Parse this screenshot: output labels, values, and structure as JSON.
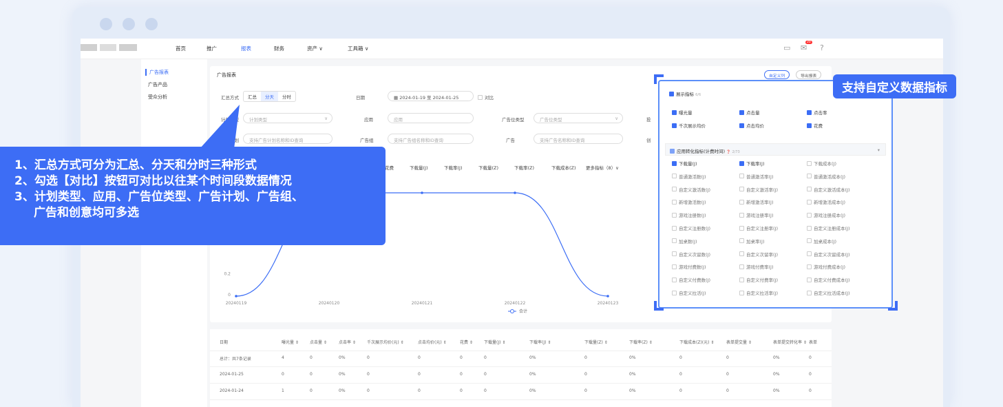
{
  "nav": {
    "items": [
      "首页",
      "推广",
      "报表",
      "财务",
      "资产 ∨",
      "工具箱 ∨"
    ],
    "active": 2,
    "icons": [
      "file-icon",
      "mail-icon",
      "help-icon"
    ],
    "badge": "20"
  },
  "sidebar": {
    "items": [
      "广告报表",
      "广告产品",
      "受众分析"
    ],
    "active": 0
  },
  "report": {
    "title": "广告报表",
    "custom_col_btn": "自定义列",
    "export_btn": "导出报表",
    "summary_label": "汇总方式",
    "summary_opts": [
      "汇总",
      "分天",
      "分时"
    ],
    "summary_active": 1,
    "date_label": "日期",
    "date_range": "2024-01-19  至  2024-01-25",
    "compare_label": "对比",
    "plan_type_label": "计划类型",
    "plan_type_ph": "计划类型",
    "app_label": "应用",
    "app_ph": "应用",
    "slot_type_label": "广告位类型",
    "slot_type_ph": "广告位类型",
    "plan_label": "广告计划",
    "plan_ph": "支持广告计划名称和ID查询",
    "group_label": "广告组",
    "group_ph": "支持广告组名称和ID查询",
    "ad_label": "广告",
    "ad_ph": "支持广告名称和ID查询",
    "cut1": "投",
    "cut2": "创"
  },
  "metric_tabs": [
    "花费",
    "下载量(J)",
    "下载率(J)",
    "下载量(Z)",
    "下载率(Z)",
    "下载成本(Z)",
    "更多指标（8）∨"
  ],
  "chart_data": {
    "type": "line",
    "x": [
      "20240119",
      "20240120",
      "20240121",
      "20240122",
      "20240123"
    ],
    "y_ticks": [
      "0",
      "0.2",
      "0.4"
    ],
    "series": [
      {
        "name": "合计",
        "values": [
          0,
          1,
          1,
          1,
          0
        ]
      }
    ],
    "legend": "bottom-center",
    "accent": "#3b6df5"
  },
  "table": {
    "headers": [
      "日期",
      "曝光量 ⇕",
      "点击量 ⇕",
      "点击率 ⇕",
      "千次展示均价(元) ⇕",
      "点击均价(元) ⇕",
      "花费 ⇕",
      "下载量(J) ⇕",
      "下载率(J) ⇕",
      "下载量(Z) ⇕",
      "下载率(Z) ⇕",
      "下载成本(Z)(元) ⇕",
      "表单提交量 ⇕",
      "表单提交转化率 ⇕",
      "表单"
    ],
    "rows": [
      [
        "总计：共7条记录",
        "4",
        "0",
        "0%",
        "0",
        "0",
        "0",
        "0",
        "0%",
        "0",
        "0%",
        "0",
        "0",
        "0%",
        "0"
      ],
      [
        "2024-01-25",
        "0",
        "0",
        "0%",
        "0",
        "0",
        "0",
        "0",
        "0%",
        "0",
        "0%",
        "0",
        "0",
        "0%",
        "0"
      ],
      [
        "2024-01-24",
        "1",
        "0",
        "0%",
        "0",
        "0",
        "0",
        "0",
        "0%",
        "0",
        "0%",
        "0",
        "0",
        "0%",
        "0"
      ]
    ]
  },
  "picker": {
    "sec1": {
      "title": "展示指标",
      "count": "6/6",
      "items": [
        "曝光量",
        "点击量",
        "点击率",
        "千次展示均价",
        "点击均价",
        "花费"
      ]
    },
    "sec2": {
      "title": "应用转化指标(计费时间)",
      "count": "2/73",
      "items": [
        "下载量(J)",
        "下载率(J)",
        "下载成本(J)",
        "普通激活数(J)",
        "普通激活率(J)",
        "普通激活成本(J)",
        "自定义激活数(J)",
        "自定义激活率(J)",
        "自定义激活成本(J)",
        "新增激活数(J)",
        "新增激活率(J)",
        "新增激活成本(J)",
        "游戏注册数(J)",
        "游戏注册率(J)",
        "游戏注册成本(J)",
        "自定义注册数(J)",
        "自定义注册率(J)",
        "自定义注册成本(J)",
        "加桌数(J)",
        "加桌率(J)",
        "加桌成本(J)",
        "自定义次留数(J)",
        "自定义次留率(J)",
        "自定义次留成本(J)",
        "游戏付费数(J)",
        "游戏付费率(J)",
        "游戏付费成本(J)",
        "自定义付费数(J)",
        "自定义付费率(J)",
        "自定义付费成本(J)",
        "自定义拉活(J)",
        "自定义拉活率(J)",
        "自定义拉活成本(J)"
      ],
      "checked": [
        0,
        1
      ]
    }
  },
  "callout": {
    "line1": "1、汇总方式可分为汇总、分天和分时三种形式",
    "line2": "2、勾选【对比】按钮可对比以往某个时间段数据情况",
    "line3": "3、计划类型、应用、广告位类型、广告计划、广告组、",
    "line4": "广告和创意均可多选"
  },
  "tag": "支持自定义数据指标"
}
